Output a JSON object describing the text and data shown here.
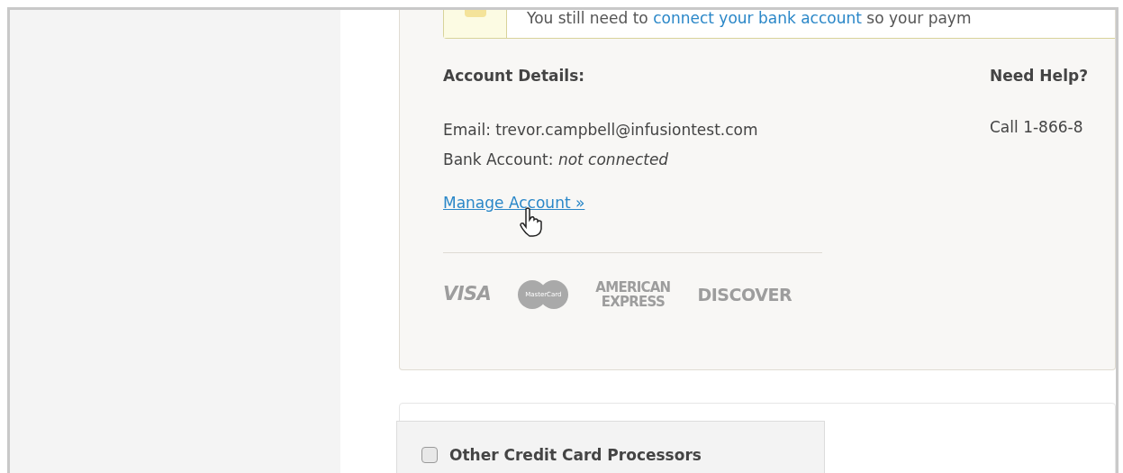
{
  "notice": {
    "text_before": "You still need to ",
    "link": "connect your bank account",
    "text_after": " so your paym"
  },
  "account_details": {
    "heading": "Account Details:",
    "email_label": "Email:",
    "email": "trevor.campbell@infusiontest.com",
    "bank_label": "Bank Account:",
    "bank_status": "not connected",
    "manage_link": "Manage Account »"
  },
  "help": {
    "heading": "Need Help?",
    "phone": "Call 1-866-8"
  },
  "card_logos": [
    {
      "kind": "visa",
      "text": "VISA"
    },
    {
      "kind": "mastercard",
      "text": "MasterCard"
    },
    {
      "kind": "amex",
      "lines": [
        "AMERICAN",
        "EXPRESS"
      ]
    },
    {
      "kind": "discover",
      "text": "DISCOVER"
    }
  ],
  "other_processors": {
    "label": "Other Credit Card Processors",
    "checked": false
  }
}
